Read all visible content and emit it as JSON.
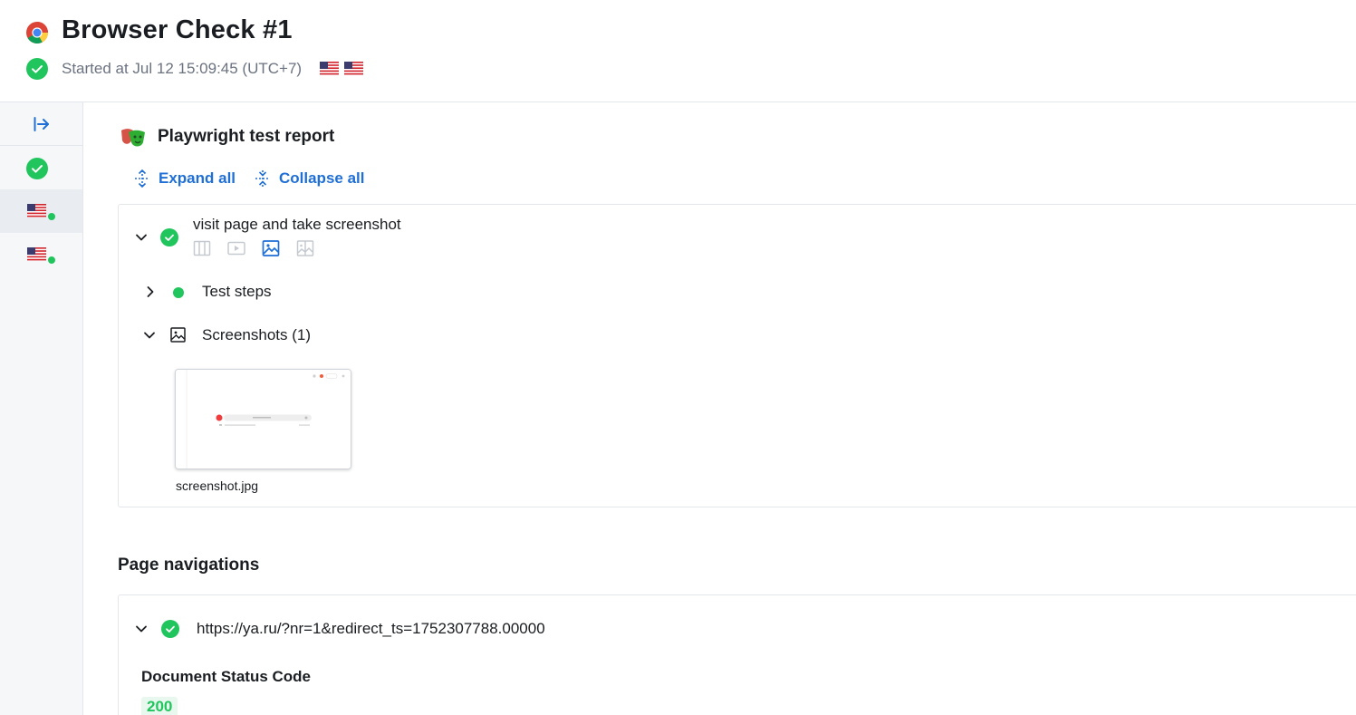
{
  "header": {
    "title": "Browser Check #1",
    "started": "Started at Jul 12 15:09:45 (UTC+7)",
    "browser_icon": "chrome-icon",
    "status_icon": "check-circle-icon",
    "locations": [
      "us-flag-icon",
      "us-flag-icon"
    ]
  },
  "sidebar": {
    "toggle_icon": "expand-sidebar-icon",
    "items": [
      {
        "icon": "check-circle-icon"
      },
      {
        "icon": "us-flag-icon",
        "status_dot": "green",
        "active": true
      },
      {
        "icon": "us-flag-icon",
        "status_dot": "green",
        "active": false
      }
    ]
  },
  "report": {
    "title": "Playwright test report",
    "icon": "playwright-masks-icon",
    "expand_all": "Expand all",
    "collapse_all": "Collapse all",
    "test": {
      "name": "visit page and take screenshot",
      "tabs": [
        "trace-icon",
        "video-icon",
        "image-icon",
        "image-diff-icon"
      ],
      "active_tab": "image-icon",
      "steps_label": "Test steps",
      "screenshots_label": "Screenshots (1)",
      "screenshot_file": "screenshot.jpg"
    }
  },
  "navigations": {
    "title": "Page navigations",
    "items": [
      {
        "url": "https://ya.ru/?nr=1&redirect_ts=1752307788.00000",
        "status_code_label": "Document Status Code",
        "status_code": "200"
      }
    ]
  },
  "colors": {
    "success": "#21c55d",
    "link": "#1f6fd6",
    "sidebar_bg": "#f6f7f9",
    "border": "#e3e6ea"
  }
}
